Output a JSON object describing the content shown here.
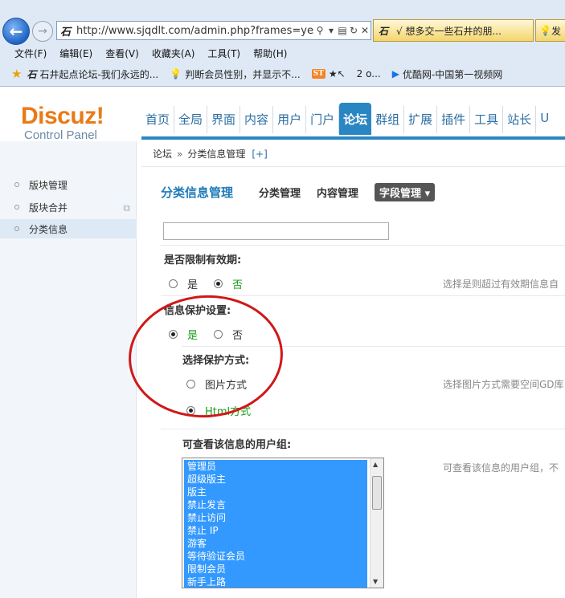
{
  "browser": {
    "address": "http://www.sjqdlt.com/admin.php?frames=yes&",
    "address_favicon": "石",
    "tabs": [
      {
        "favicon": "石",
        "label": "√ 想多交一些石井的朋..."
      },
      {
        "favicon": "💡",
        "label": "发"
      }
    ],
    "menu": [
      "文件(F)",
      "编辑(E)",
      "查看(V)",
      "收藏夹(A)",
      "工具(T)",
      "帮助(H)"
    ],
    "favorites": [
      {
        "icon": "石",
        "label": "石井起点论坛-我们永远的..."
      },
      {
        "icon": "💡",
        "label": "判断会员性别，并显示不..."
      },
      {
        "icon": "ST",
        "label": "★↖"
      },
      {
        "icon": "",
        "label": "2 o..."
      },
      {
        "icon": "▶",
        "label": "优酷网-中国第一视频网"
      }
    ]
  },
  "logo": {
    "main": "Discuz!",
    "sub": "Control Panel"
  },
  "topnav": [
    "首页",
    "全局",
    "界面",
    "内容",
    "用户",
    "门户",
    "论坛",
    "群组",
    "扩展",
    "插件",
    "工具",
    "站长",
    "U"
  ],
  "topnav_active": "论坛",
  "breadcrumb": {
    "root": "论坛",
    "sep": "»",
    "current": "分类信息管理",
    "add": "[+]"
  },
  "sidebar": {
    "items": [
      "版块管理",
      "版块合并",
      "分类信息"
    ],
    "active": "分类信息"
  },
  "page": {
    "title": "分类信息管理",
    "tabs": [
      "分类管理",
      "内容管理",
      "字段管理 ▾"
    ],
    "active_tab": "字段管理 ▾"
  },
  "form": {
    "expire": {
      "label": "是否限制有效期:",
      "yes": "是",
      "no": "否",
      "selected": "否",
      "tip": "选择是则超过有效期信息自"
    },
    "protect": {
      "label": "信息保护设置:",
      "yes": "是",
      "no": "否",
      "selected": "是"
    },
    "protect_method": {
      "label": "选择保护方式:",
      "image": "图片方式",
      "html": "Html方式",
      "selected": "Html方式",
      "tip": "选择图片方式需要空间GD库"
    },
    "usergroups": {
      "label": "可查看该信息的用户组:",
      "tip": "可查看该信息的用户组，不",
      "items": [
        "管理员",
        "超级版主",
        "版主",
        "禁止发言",
        "禁止访问",
        "禁止 IP",
        "游客",
        "等待验证会员",
        "限制会员",
        "新手上路"
      ]
    }
  },
  "colors": {
    "accent": "#2a86c3",
    "logo": "#e87b18",
    "selected_green": "#1a9c1a",
    "list_highlight": "#3399ff",
    "annotation": "#d01818"
  }
}
